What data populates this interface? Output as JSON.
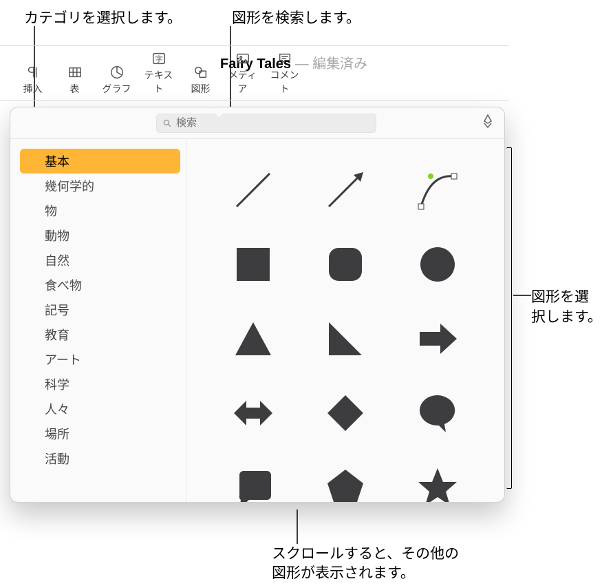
{
  "callouts": {
    "cat": "カテゴリを選択します。",
    "search": "図形を検索します。",
    "pick1": "図形を選",
    "pick2": "択します。",
    "scroll1": "スクロールすると、その他の",
    "scroll2": "図形が表示されます。"
  },
  "doc": {
    "title": "Fairy Tales",
    "status": "編集済み"
  },
  "toolbar": {
    "insert": "挿入",
    "table": "表",
    "chart": "グラフ",
    "text": "テキスト",
    "shape": "図形",
    "media": "メディア",
    "comment": "コメント"
  },
  "search": {
    "placeholder": "検索"
  },
  "categories": [
    "基本",
    "幾何学的",
    "物",
    "動物",
    "自然",
    "食べ物",
    "記号",
    "教育",
    "アート",
    "科学",
    "人々",
    "場所",
    "活動"
  ],
  "selected_category_index": 0,
  "shapes": [
    "line",
    "arrow-line",
    "curve",
    "square",
    "rounded-square",
    "circle",
    "triangle",
    "right-triangle",
    "arrow-right",
    "double-arrow",
    "diamond",
    "speech",
    "callout-sq",
    "pentagon",
    "star"
  ]
}
